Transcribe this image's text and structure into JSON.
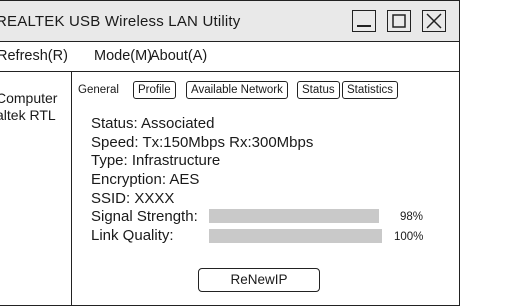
{
  "window": {
    "title": "REALTEK USB Wireless LAN Utility"
  },
  "menu": {
    "items": [
      "Refresh(R)",
      "Mode(M)",
      "About(A)"
    ]
  },
  "sidebar": {
    "lines": [
      "Computer",
      "altek RTL"
    ]
  },
  "tabs": {
    "current_label": "General",
    "items": [
      "Profile",
      "Available Network",
      "Status",
      "Statistics"
    ]
  },
  "status": {
    "status_line": "Status: Associated",
    "speed_line": "Speed:  Tx:150Mbps Rx:300Mbps",
    "type_line": "Type:  Infrastructure",
    "encryption_line": "Encryption:  AES",
    "ssid_line": "SSID:  XXXX",
    "signal_label": "Signal Strength:",
    "signal_percent": "98%",
    "signal_value": 0.98,
    "link_label": "Link Quality:",
    "link_percent": "100%",
    "link_value": 1.0
  },
  "actions": {
    "renew_label": "ReNewIP"
  }
}
